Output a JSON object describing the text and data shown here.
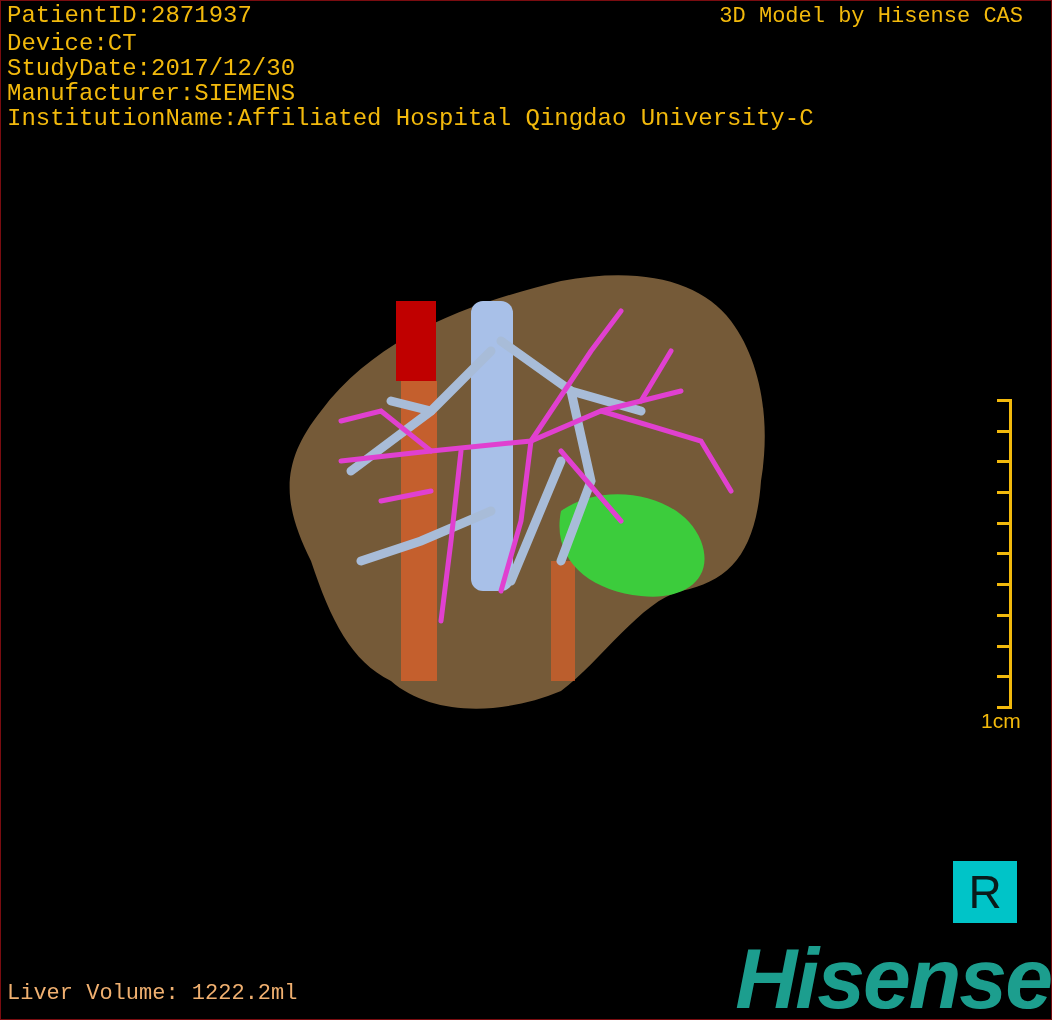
{
  "study_info": [
    "PatientID:2871937",
    "Device:CT",
    "StudyDate:2017/12/30",
    "Manufacturer:SIEMENS",
    "InstitutionName:Affiliated Hospital Qingdao University-C"
  ],
  "credit": "3D Model by Hisense CAS",
  "scale_bar": {
    "label": "1cm"
  },
  "orientation": "R",
  "liver_volume": "Liver Volume: 1222.2ml",
  "logo": "Hisense"
}
